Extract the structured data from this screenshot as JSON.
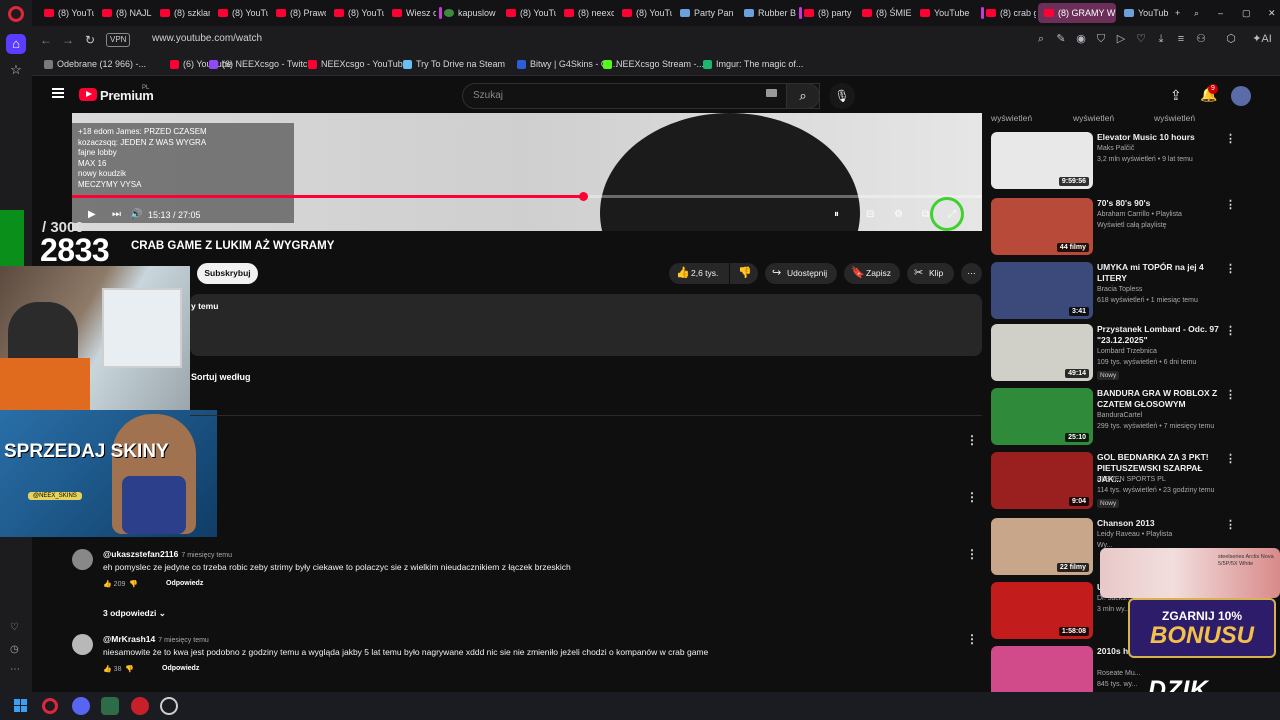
{
  "browser": {
    "tabs": [
      {
        "label": "(8) YouTu",
        "type": "yt"
      },
      {
        "label": "(8) NAJLE",
        "type": "yt"
      },
      {
        "label": "(8) szklan",
        "type": "yt"
      },
      {
        "label": "(8) YouTu",
        "type": "yt"
      },
      {
        "label": "(8) Prawd",
        "type": "yt"
      },
      {
        "label": "(8) YouTu",
        "type": "yt"
      },
      {
        "label": "Wiesz co",
        "type": "yt"
      },
      {
        "label": "kapuslow",
        "type": "g"
      },
      {
        "label": "(8) YouTu",
        "type": "yt"
      },
      {
        "label": "(8) neexc",
        "type": "yt"
      },
      {
        "label": "(8) YouTu",
        "type": "yt"
      },
      {
        "label": "Party Pan",
        "type": "s"
      },
      {
        "label": "Rubber B",
        "type": "s"
      },
      {
        "label": "(8) party",
        "type": "yt"
      },
      {
        "label": "(8) ŚMIE",
        "type": "yt"
      },
      {
        "label": "YouTube",
        "type": "yt"
      },
      {
        "label": "(8) crab g",
        "type": "yt"
      },
      {
        "label": "(8) GRAMY W CF",
        "type": "yt"
      },
      {
        "label": "YouTube",
        "type": "s"
      }
    ],
    "url": "www.youtube.com/watch",
    "vpn": "VPN",
    "bookmarks": [
      {
        "label": "Odebrane (12 966) -...",
        "icon": "mail"
      },
      {
        "label": "(6) YouTube",
        "icon": "yt"
      },
      {
        "label": "(6) NEEXcsgo - Twitch",
        "icon": "tw"
      },
      {
        "label": "NEEXcsgo - YouTube",
        "icon": "yt"
      },
      {
        "label": "Try To Drive na Steam",
        "icon": "st"
      },
      {
        "label": "Bitwy | G4Skins - Ot...",
        "icon": "g4"
      },
      {
        "label": "NEEXcsgo Stream -...",
        "icon": "kk"
      },
      {
        "label": "Imgur: The magic of...",
        "icon": "im"
      }
    ]
  },
  "yt": {
    "brand": "Premium",
    "brand_region": "PL",
    "search_placeholder": "Szukaj",
    "notification_count": "9"
  },
  "video": {
    "time": "15:13 / 27:05",
    "progress_fraction": 0.562,
    "chat_lines": [
      "+18 edom James: PRZED CZASEM",
      "kozaczsqq: JEDEN Z WAS WYGRA",
      "fajne lobby",
      "MAX 16",
      "nowy koudzik",
      "MECZYMY VYSA"
    ]
  },
  "stream_overlay": {
    "counter_small": "/ 3000",
    "counter_big": "2833",
    "promo_title": "SPRZEDAJ SKINY",
    "promo_badge": "@NEEX_SKINS"
  },
  "watch": {
    "title": "CRAB GAME Z LUKIM AŻ WYGRAMY",
    "subscribe": "Subskrybuj",
    "likes": "2,6 tys.",
    "share": "Udostępnij",
    "save": "Zapisz",
    "clip": "Klip",
    "desc_time": "y temu",
    "sort": "Sortuj według"
  },
  "comments": [
    {
      "user": "@ukaszstefan2116",
      "time": "7 miesięcy temu",
      "text": "eh pomyslec ze jedyne co trzeba robic zeby strimy były ciekawe to polaczyc sie z wielkim nieudacznikiem z łączek brzeskich",
      "likes": "209",
      "reply": "Odpowiedz",
      "replies": "3 odpowiedzi"
    },
    {
      "user": "@MrKrash14",
      "time": "7 miesięcy temu",
      "text": "niesamowite że to kwa jest podobno z godziny temu a wygląda jakby 5 lat temu było nagrywane xddd nic sie nie zmieniło jeżeli chodzi o kompanów w crab game",
      "likes": "38",
      "reply": "Odpowiedz"
    }
  ],
  "sidebar": {
    "header_labels": [
      "wyświetleń",
      "wyświetleń",
      "wyświetleń"
    ],
    "items": [
      {
        "title": "Elevator Music 10 hours",
        "channel": "Maks Palčič",
        "meta": "3,2 mln wyświetleń • 9 lat temu",
        "duration": "9:59:56",
        "color": "#e8e8e8"
      },
      {
        "title": "70's 80's 90's",
        "channel": "Abraham Carrillo • Playlista",
        "meta": "Wyświetl całą playlistę",
        "duration": "44 filmy",
        "color": "#b84a3a"
      },
      {
        "title": "UMYKA mi TOPÓR na jej 4 LITERY",
        "channel": "Bracia Topless",
        "meta": "618 wyświetleń • 1 miesiąc temu",
        "duration": "3:41",
        "color": "#3b4a7a"
      },
      {
        "title": "Przystanek Lombard - Odc. 97 \"23.12.2025\"",
        "channel": "Lombard Trzebnica",
        "meta": "109 tys. wyświetleń • 6 dni temu",
        "badge": "Nowy",
        "duration": "49:14",
        "color": "#d0cfc8"
      },
      {
        "title": "BANDURA GRA W ROBLOX Z CZATEM GŁOSOWYM",
        "channel": "BanduraCartel",
        "meta": "299 tys. wyświetleń • 7 miesięcy temu",
        "duration": "25:10",
        "color": "#2f8a3a"
      },
      {
        "title": "GOL BEDNARKA ZA 3 PKT! PIETUSZEWSKI SZARPAŁ JAK...",
        "channel": "ELEVEN SPORTS PL",
        "meta": "114 tys. wyświetleń • 23 godziny temu",
        "badge": "Nowy",
        "duration": "9:04",
        "color": "#9a2020"
      },
      {
        "title": "Chanson 2013",
        "channel": "Leidy Raveau • Playlista",
        "meta": "Wy...",
        "duration": "22 filmy",
        "color": "#c7a68a"
      },
      {
        "title": "Ul...",
        "channel": "Dr. Jacks...",
        "meta": "3 mln wy...",
        "duration": "1:58:08",
        "color": "#c21c1c"
      },
      {
        "title": "2010s h... ~throwback playlist",
        "channel": "Roseate Mu...",
        "meta": "845 tys. wy...",
        "duration": "",
        "color": "#d14a8a"
      }
    ]
  },
  "ads": {
    "steel_text": "steelseries Arctis Nova 5/5P/5X White",
    "bonus_line1": "ZGARNIJ 10%",
    "bonus_line2": "BONUSU",
    "dzik": "DZIK"
  }
}
